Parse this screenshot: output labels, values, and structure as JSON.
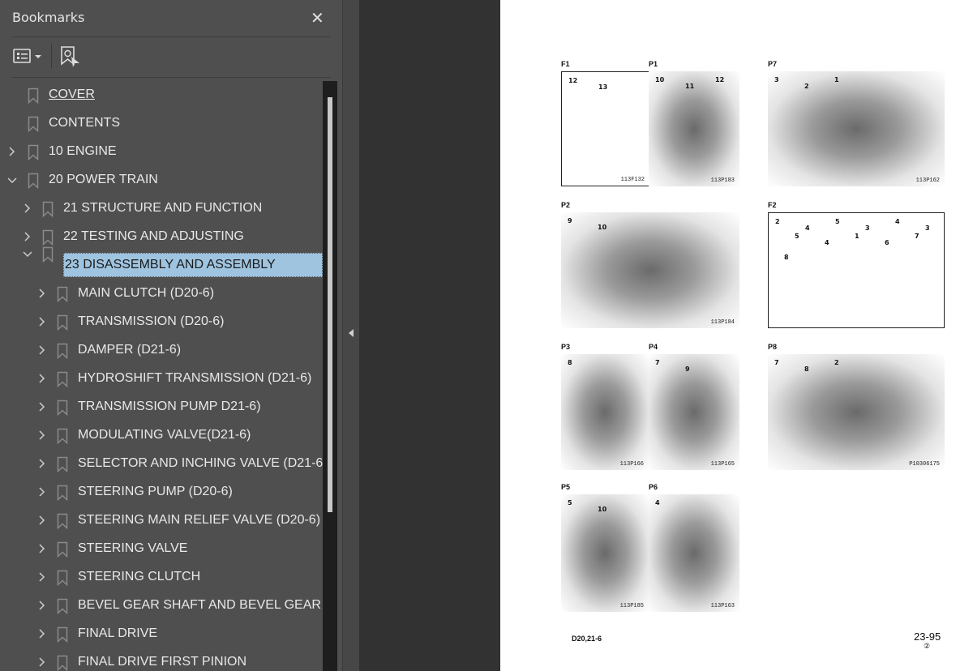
{
  "panel": {
    "title": "Bookmarks",
    "close_icon": "close-icon",
    "options_icon": "list-options-icon",
    "find_icon": "find-bookmark-icon"
  },
  "bookmarks": [
    {
      "label": "COVER",
      "level": 0,
      "state": "none",
      "underline": true
    },
    {
      "label": "CONTENTS",
      "level": 0,
      "state": "none"
    },
    {
      "label": "10 ENGINE",
      "level": 0,
      "state": "collapsed"
    },
    {
      "label": "20 POWER TRAIN",
      "level": 0,
      "state": "expanded"
    },
    {
      "label": "21 STRUCTURE AND FUNCTION",
      "level": 1,
      "state": "collapsed"
    },
    {
      "label": "22 TESTING AND ADJUSTING",
      "level": 1,
      "state": "collapsed"
    },
    {
      "label": "23 DISASSEMBLY AND ASSEMBLY",
      "level": 1,
      "state": "expanded",
      "selected": true
    },
    {
      "label": "MAIN CLUTCH (D20-6)",
      "level": 2,
      "state": "collapsed"
    },
    {
      "label": "TRANSMISSION (D20-6)",
      "level": 2,
      "state": "collapsed"
    },
    {
      "label": "DAMPER (D21-6)",
      "level": 2,
      "state": "collapsed"
    },
    {
      "label": "HYDROSHIFT TRANSMISSION (D21-6)",
      "level": 2,
      "state": "collapsed"
    },
    {
      "label": "TRANSMISSION PUMP D21-6)",
      "level": 2,
      "state": "collapsed"
    },
    {
      "label": "MODULATING VALVE(D21-6)",
      "level": 2,
      "state": "collapsed"
    },
    {
      "label": "SELECTOR AND INCHING VALVE (D21-6)",
      "level": 2,
      "state": "collapsed"
    },
    {
      "label": "STEERING PUMP (D20-6)",
      "level": 2,
      "state": "collapsed"
    },
    {
      "label": "STEERING MAIN RELIEF VALVE (D20-6)",
      "level": 2,
      "state": "collapsed"
    },
    {
      "label": "STEERING VALVE",
      "level": 2,
      "state": "collapsed"
    },
    {
      "label": "STEERING CLUTCH",
      "level": 2,
      "state": "collapsed"
    },
    {
      "label": "BEVEL GEAR SHAFT AND BEVEL GEAR",
      "level": 2,
      "state": "collapsed"
    },
    {
      "label": "FINAL DRIVE",
      "level": 2,
      "state": "collapsed"
    },
    {
      "label": "FINAL DRIVE FIRST PINION",
      "level": 2,
      "state": "collapsed"
    }
  ],
  "colors": {
    "selected": "#9fc4e0",
    "panel": "#4f4f4f",
    "page": "#ffffff"
  },
  "document": {
    "figures": [
      {
        "id": "F1",
        "kind": "drawing",
        "caption": "113F132",
        "callouts": [
          "12",
          "13"
        ]
      },
      {
        "id": "P1",
        "kind": "photo",
        "caption": "113P183",
        "callouts": [
          "10",
          "11",
          "12"
        ]
      },
      {
        "id": "P7",
        "kind": "photo",
        "caption": "113P162",
        "callouts": [
          "3",
          "2",
          "1"
        ]
      },
      {
        "id": "P2",
        "kind": "photo",
        "caption": "113P184",
        "callouts": [
          "9",
          "10"
        ]
      },
      {
        "id": "F2",
        "kind": "drawing",
        "caption": "",
        "callouts": [
          "2",
          "4",
          "5",
          "3",
          "4",
          "3",
          "5",
          "4",
          "1",
          "6",
          "7",
          "8"
        ]
      },
      {
        "id": "P3",
        "kind": "photo",
        "caption": "113P166",
        "callouts": [
          "8"
        ]
      },
      {
        "id": "P4",
        "kind": "photo",
        "caption": "113P165",
        "callouts": [
          "7",
          "9"
        ]
      },
      {
        "id": "P8",
        "kind": "photo",
        "caption": "P10306175",
        "callouts": [
          "7",
          "8",
          "2"
        ]
      },
      {
        "id": "P5",
        "kind": "photo",
        "caption": "113P185",
        "callouts": [
          "5",
          "10"
        ]
      },
      {
        "id": "P6",
        "kind": "photo",
        "caption": "113P163",
        "callouts": [
          "4"
        ]
      }
    ],
    "footer_left": "D20,21-6",
    "page_number": "23-95",
    "revision": "②"
  }
}
